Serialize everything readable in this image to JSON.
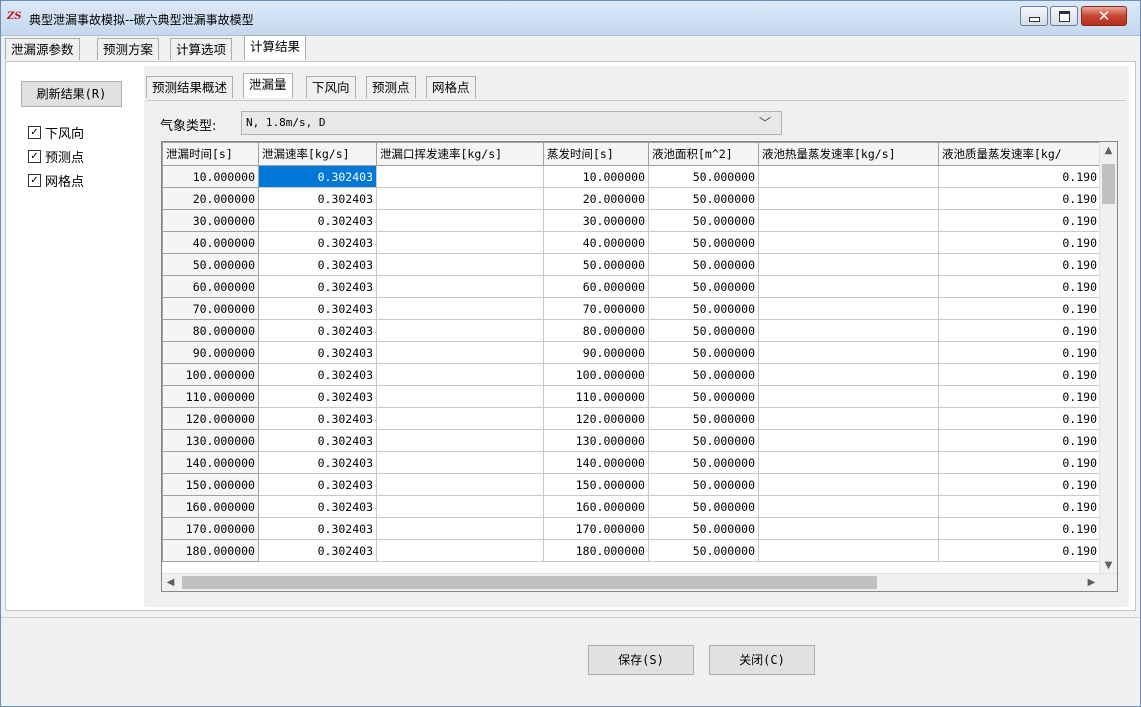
{
  "window": {
    "title": "典型泄漏事故模拟--碳六典型泄漏事故模型",
    "icon": "app-logo-icon",
    "icon_text": "ZS"
  },
  "main_tabs": [
    {
      "label": "泄漏源参数",
      "active": false
    },
    {
      "label": "预测方案",
      "active": false
    },
    {
      "label": "计算选项",
      "active": false
    },
    {
      "label": "计算结果",
      "active": true
    }
  ],
  "left_panel": {
    "refresh_label": "刷新结果(R)",
    "checkboxes": [
      {
        "label": "下风向",
        "checked": true
      },
      {
        "label": "预测点",
        "checked": true
      },
      {
        "label": "网格点",
        "checked": true
      }
    ]
  },
  "sub_tabs": [
    {
      "label": "预测结果概述",
      "active": false
    },
    {
      "label": "泄漏量",
      "active": true
    },
    {
      "label": "下风向",
      "active": false
    },
    {
      "label": "预测点",
      "active": false
    },
    {
      "label": "网格点",
      "active": false
    }
  ],
  "weather": {
    "label": "气象类型:",
    "value": "N, 1.8m/s, D"
  },
  "grid": {
    "columns": [
      "泄漏时间[s]",
      "泄漏速率[kg/s]",
      "泄漏口挥发速率[kg/s]",
      "蒸发时间[s]",
      "液池面积[m^2]",
      "液池热量蒸发速率[kg/s]",
      "液池质量蒸发速率[kg/"
    ],
    "rows": [
      [
        "10.000000",
        "0.302403",
        "",
        "10.000000",
        "50.000000",
        "",
        "0.190"
      ],
      [
        "20.000000",
        "0.302403",
        "",
        "20.000000",
        "50.000000",
        "",
        "0.190"
      ],
      [
        "30.000000",
        "0.302403",
        "",
        "30.000000",
        "50.000000",
        "",
        "0.190"
      ],
      [
        "40.000000",
        "0.302403",
        "",
        "40.000000",
        "50.000000",
        "",
        "0.190"
      ],
      [
        "50.000000",
        "0.302403",
        "",
        "50.000000",
        "50.000000",
        "",
        "0.190"
      ],
      [
        "60.000000",
        "0.302403",
        "",
        "60.000000",
        "50.000000",
        "",
        "0.190"
      ],
      [
        "70.000000",
        "0.302403",
        "",
        "70.000000",
        "50.000000",
        "",
        "0.190"
      ],
      [
        "80.000000",
        "0.302403",
        "",
        "80.000000",
        "50.000000",
        "",
        "0.190"
      ],
      [
        "90.000000",
        "0.302403",
        "",
        "90.000000",
        "50.000000",
        "",
        "0.190"
      ],
      [
        "100.000000",
        "0.302403",
        "",
        "100.000000",
        "50.000000",
        "",
        "0.190"
      ],
      [
        "110.000000",
        "0.302403",
        "",
        "110.000000",
        "50.000000",
        "",
        "0.190"
      ],
      [
        "120.000000",
        "0.302403",
        "",
        "120.000000",
        "50.000000",
        "",
        "0.190"
      ],
      [
        "130.000000",
        "0.302403",
        "",
        "130.000000",
        "50.000000",
        "",
        "0.190"
      ],
      [
        "140.000000",
        "0.302403",
        "",
        "140.000000",
        "50.000000",
        "",
        "0.190"
      ],
      [
        "150.000000",
        "0.302403",
        "",
        "150.000000",
        "50.000000",
        "",
        "0.190"
      ],
      [
        "160.000000",
        "0.302403",
        "",
        "160.000000",
        "50.000000",
        "",
        "0.190"
      ],
      [
        "170.000000",
        "0.302403",
        "",
        "170.000000",
        "50.000000",
        "",
        "0.190"
      ],
      [
        "180.000000",
        "0.302403",
        "",
        "180.000000",
        "50.000000",
        "",
        "0.190"
      ]
    ],
    "selected_cell": "0.302403"
  },
  "footer": {
    "save_label": "保存(S)",
    "close_label": "关闭(C)"
  },
  "colors": {
    "selection": "#0078d7",
    "titlebar": "#c4d7ee",
    "close_button": "#c8452f"
  }
}
